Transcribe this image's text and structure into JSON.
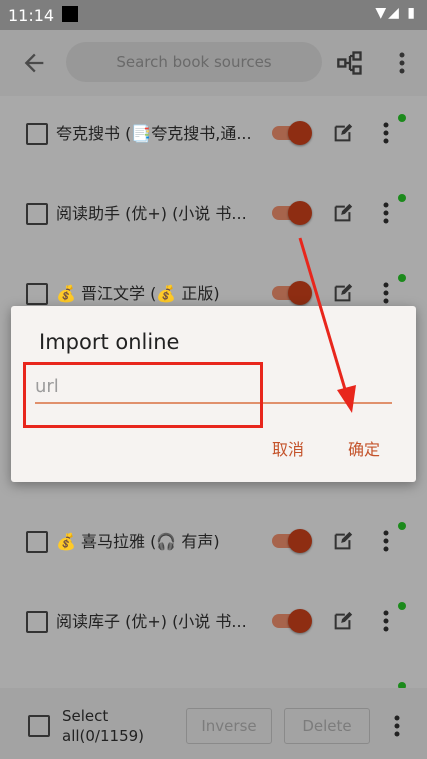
{
  "status_bar": {
    "time": "11:14",
    "icons": "▼◢ ▮"
  },
  "toolbar": {
    "back_icon": "arrow-back-icon",
    "search_placeholder": "Search book sources",
    "tree_icon": "group-tree-icon",
    "more_icon": "more-vert-icon"
  },
  "rows": [
    {
      "label": "夸克搜书 (📑夸克搜书,通...",
      "enabled": true
    },
    {
      "label": "阅读助手 (优+) (小说 书...",
      "enabled": true
    },
    {
      "label": "💰 晋江文学 (💰 正版)",
      "enabled": true
    },
    {
      "label": "💰 喜马拉雅 (🎧 有声)",
      "enabled": true
    },
    {
      "label": "阅读库子 (优+) (小说 书...",
      "enabled": true
    }
  ],
  "bottom_bar": {
    "select_all": "Select all(0/1159)",
    "inverse_label": "Inverse",
    "delete_label": "Delete"
  },
  "dialog": {
    "title": "Import online",
    "placeholder": "url",
    "cancel_label": "取消",
    "confirm_label": "确定"
  },
  "colors": {
    "accent": "#c4532b",
    "annotation": "#e8261c",
    "toggle_on": "#8e2d12",
    "enabled_dot": "#1c8a1c"
  }
}
